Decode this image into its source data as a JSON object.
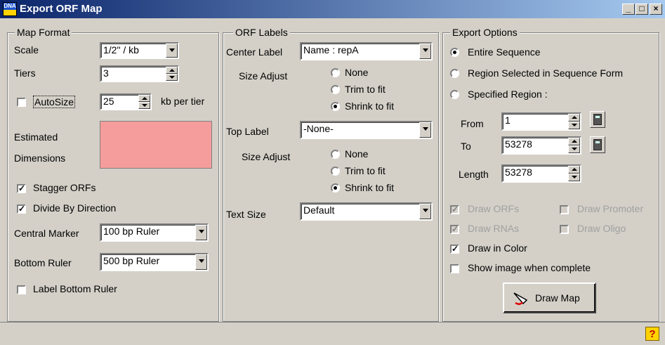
{
  "window": {
    "title": "Export ORF Map",
    "icon_label": "DNA",
    "buttons": {
      "minimize": "_",
      "maximize": "□",
      "close": "×"
    }
  },
  "map_format": {
    "title": "Map Format",
    "scale_label": "Scale",
    "scale_value": "1/2\" / kb",
    "tiers_label": "Tiers",
    "tiers_value": "3",
    "autosize_label": "AutoSize",
    "autosize_checked": false,
    "kb_value": "25",
    "kb_label": "kb per tier",
    "estimated_label": "Estimated",
    "dimensions_label": "Dimensions",
    "dimensions_color": "#f59c9c",
    "stagger_label": "Stagger ORFs",
    "stagger_checked": true,
    "divide_label": "Divide By Direction",
    "divide_checked": true,
    "central_marker_label": "Central Marker",
    "central_marker_value": "100 bp Ruler",
    "bottom_ruler_label": "Bottom Ruler",
    "bottom_ruler_value": "500 bp Ruler",
    "label_bottom_label": "Label Bottom Ruler",
    "label_bottom_checked": false
  },
  "orf_labels": {
    "title": "ORF Labels",
    "center_label": "Center Label",
    "center_value": "Name : repA",
    "size_adjust_label": "Size Adjust",
    "opt_none": "None",
    "opt_trim": "Trim to fit",
    "opt_shrink": "Shrink to fit",
    "center_selected": "Shrink to fit",
    "top_label": "Top Label",
    "top_value": "-None-",
    "top_selected": "Shrink to fit",
    "text_size_label": "Text Size",
    "text_size_value": "Default"
  },
  "export_options": {
    "title": "Export Options",
    "opt_entire": "Entire Sequence",
    "opt_region_selected": "Region Selected  in Sequence Form",
    "opt_specified": "Specified Region :",
    "selected": "Entire Sequence",
    "from_label": "From",
    "from_value": "1",
    "to_label": "To",
    "to_value": "53278",
    "length_label": "Length",
    "length_value": "53278",
    "draw_orfs": "Draw ORFs",
    "draw_promoter": "Draw Promoter",
    "draw_rnas": "Draw RNAs",
    "draw_oligo": "Draw Oligo",
    "draw_color": "Draw in Color",
    "draw_color_checked": true,
    "show_image": "Show image when complete",
    "show_image_checked": false,
    "draw_map_button": "Draw Map"
  },
  "status_bar": {
    "help_glyph": "?"
  },
  "glyphs": {
    "check": "✓"
  }
}
